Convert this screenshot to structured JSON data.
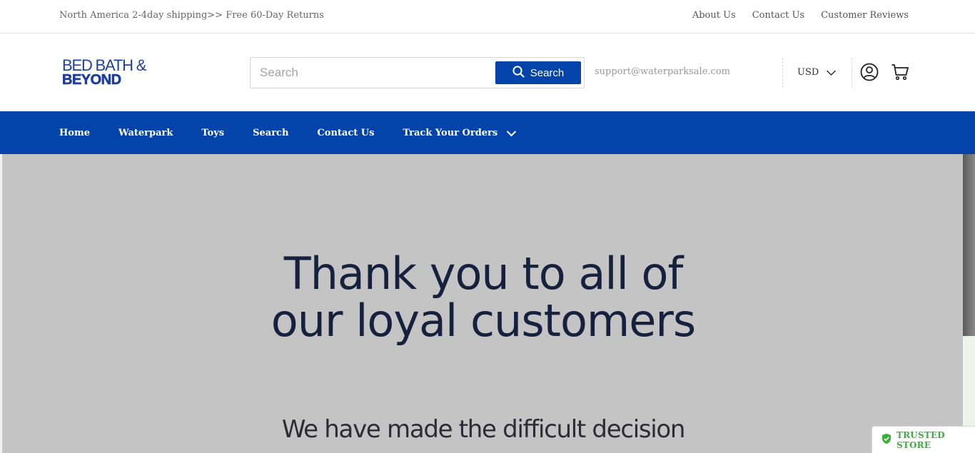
{
  "topbar": {
    "promo": "North America 2-4day shipping>> Free 60-Day Returns",
    "links": [
      "About Us",
      "Contact Us",
      "Customer Reviews"
    ]
  },
  "header": {
    "logo": {
      "line1": "BED BATH &",
      "line2": "BEYOND"
    },
    "search": {
      "placeholder": "Search",
      "value": "",
      "button_label": "Search"
    },
    "support_email": "support@waterparksale.com",
    "currency": "USD",
    "icons": {
      "account": "account-icon",
      "cart": "cart-icon",
      "search": "search-icon",
      "chevron": "chevron-down-icon"
    }
  },
  "nav": {
    "items": [
      "Home",
      "Waterpark",
      "Toys",
      "Search",
      "Contact Us",
      "Track Your Orders"
    ]
  },
  "hero": {
    "headline_line1": "Thank you to all of",
    "headline_line2": "our loyal customers",
    "subtext": "We have made the difficult decision"
  },
  "badge": {
    "label": "TRUSTED STORE",
    "icon": "shield-check-icon"
  },
  "colors": {
    "brand_blue": "#0444aa",
    "logo_blue": "#1f3f9e",
    "hero_bg": "#c4c4c5",
    "trusted_green": "#3cae3b"
  }
}
